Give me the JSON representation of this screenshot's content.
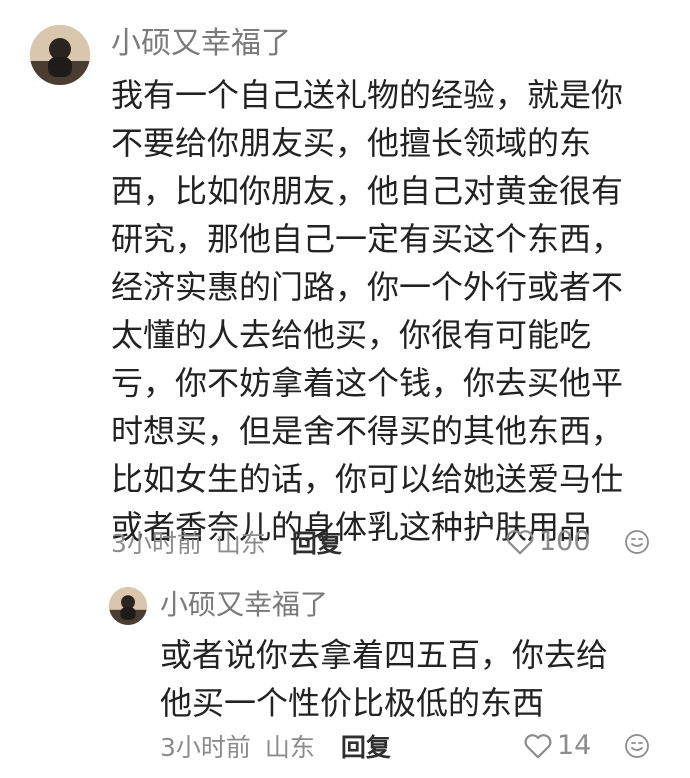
{
  "comment": {
    "username": "小硕又幸福了",
    "lines": [
      "我有一个自己送礼物的经验，就是你",
      "不要给你朋友买，他擅长领域的东",
      "西，比如你朋友，他自己对黄金很有",
      "研究，那他自己一定有买这个东西，",
      "经济实惠的门路，你一个外行或者不",
      "太懂的人去给他买，你很有可能吃",
      "亏，你不妨拿着这个钱，你去买他平",
      "时想买，但是舍不得买的其他东西，",
      "比如女生的话，你可以给她送爱马仕",
      "或者香奈儿的身体乳这种护肤用品"
    ],
    "time": "3小时前",
    "location": "山东",
    "reply_label": "回复",
    "likes": "100",
    "like_icon": "heart-outline-icon",
    "emoji_icon": "emoji-face-icon"
  },
  "reply": {
    "username": "小硕又幸福了",
    "lines": [
      "或者说你去拿着四五百，你去给",
      "他买一个性价比极低的东西"
    ],
    "time": "3小时前",
    "location": "山东",
    "reply_label": "回复",
    "likes": "14",
    "like_icon": "heart-outline-icon",
    "emoji_icon": "emoji-face-icon"
  },
  "colors": {
    "username": "#7a7a7a",
    "content": "#222222",
    "meta": "#8c8c8c",
    "reply_action": "#2f2f2f"
  }
}
